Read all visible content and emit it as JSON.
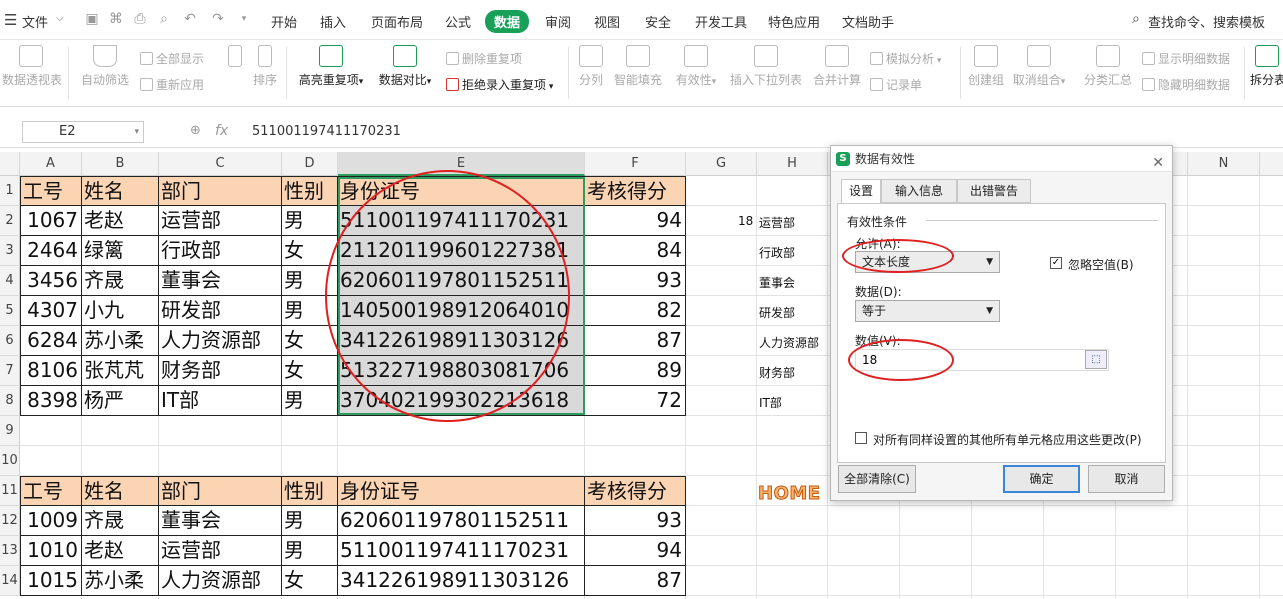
{
  "menubar": {
    "file_label": "文件",
    "items": [
      "开始",
      "插入",
      "页面布局",
      "公式",
      "数据",
      "审阅",
      "视图",
      "安全",
      "开发工具",
      "特色应用",
      "文档助手"
    ],
    "active_item": "数据",
    "search_label": "查找命令、搜索模板"
  },
  "toolbar": {
    "pivot": "数据透视表",
    "autofilter": "自动筛选",
    "show_all": "全部显示",
    "reapply": "重新应用",
    "sort": "排序",
    "highlight_dup": "高亮重复项",
    "compare": "数据对比",
    "delete_dup": "删除重复项",
    "reject_dup": "拒绝录入重复项",
    "split": "分列",
    "smart_fill": "智能填充",
    "validity": "有效性",
    "insert_dropdown": "插入下拉列表",
    "merge_calc": "合并计算",
    "simulation": "模拟分析",
    "record": "记录单",
    "create_group": "创建组",
    "ungroup": "取消组合",
    "subtotal": "分类汇总",
    "show_detail": "显示明细数据",
    "hide_detail": "隐藏明细数据",
    "split_sheet": "拆分表"
  },
  "formula_bar": {
    "name_box": "E2",
    "fx": "fx",
    "value": "511001197411170231"
  },
  "columns": [
    "A",
    "B",
    "C",
    "D",
    "E",
    "F",
    "G",
    "H",
    "N"
  ],
  "rows": [
    "1",
    "2",
    "3",
    "4",
    "5",
    "6",
    "7",
    "8",
    "9",
    "10",
    "11",
    "12",
    "13",
    "14"
  ],
  "table1": {
    "headers": [
      "工号",
      "姓名",
      "部门",
      "性别",
      "身份证号",
      "考核得分"
    ],
    "rows": [
      [
        "1067",
        "老赵",
        "运营部",
        "男",
        "511001197411170231",
        "94"
      ],
      [
        "2464",
        "绿篱",
        "行政部",
        "女",
        "211201199601227381",
        "84"
      ],
      [
        "3456",
        "齐晟",
        "董事会",
        "男",
        "620601197801152511",
        "93"
      ],
      [
        "4307",
        "小九",
        "研发部",
        "男",
        "140500198912064010",
        "82"
      ],
      [
        "6284",
        "苏小柔",
        "人力资源部",
        "女",
        "341226198911303126",
        "87"
      ],
      [
        "8106",
        "张芃芃",
        "财务部",
        "女",
        "513227198803081706",
        "89"
      ],
      [
        "8398",
        "杨严",
        "IT部",
        "男",
        "370402199302213618",
        "72"
      ]
    ]
  },
  "table2": {
    "headers": [
      "工号",
      "姓名",
      "部门",
      "性别",
      "身份证号",
      "考核得分"
    ],
    "rows": [
      [
        "1009",
        "齐晟",
        "董事会",
        "男",
        "620601197801152511",
        "93"
      ],
      [
        "1010",
        "老赵",
        "运营部",
        "男",
        "511001197411170231",
        "94"
      ],
      [
        "1015",
        "苏小柔",
        "人力资源部",
        "女",
        "341226198911303126",
        "87"
      ]
    ]
  },
  "g2_value": "18",
  "h_column": [
    "运营部",
    "行政部",
    "董事会",
    "研发部",
    "人力资源部",
    "财务部",
    "IT部"
  ],
  "logo_text": "HOME",
  "dialog": {
    "title": "数据有效性",
    "tabs": [
      "设置",
      "输入信息",
      "出错警告"
    ],
    "section": "有效性条件",
    "allow_label": "允许(A):",
    "allow_value": "文本长度",
    "ignore_blank": "忽略空值(B)",
    "data_label": "数据(D):",
    "data_value": "等于",
    "value_label": "数值(V):",
    "value_value": "18",
    "apply_all": "对所有同样设置的其他所有单元格应用这些更改(P)",
    "clear_all": "全部清除(C)",
    "ok": "确定",
    "cancel": "取消"
  }
}
